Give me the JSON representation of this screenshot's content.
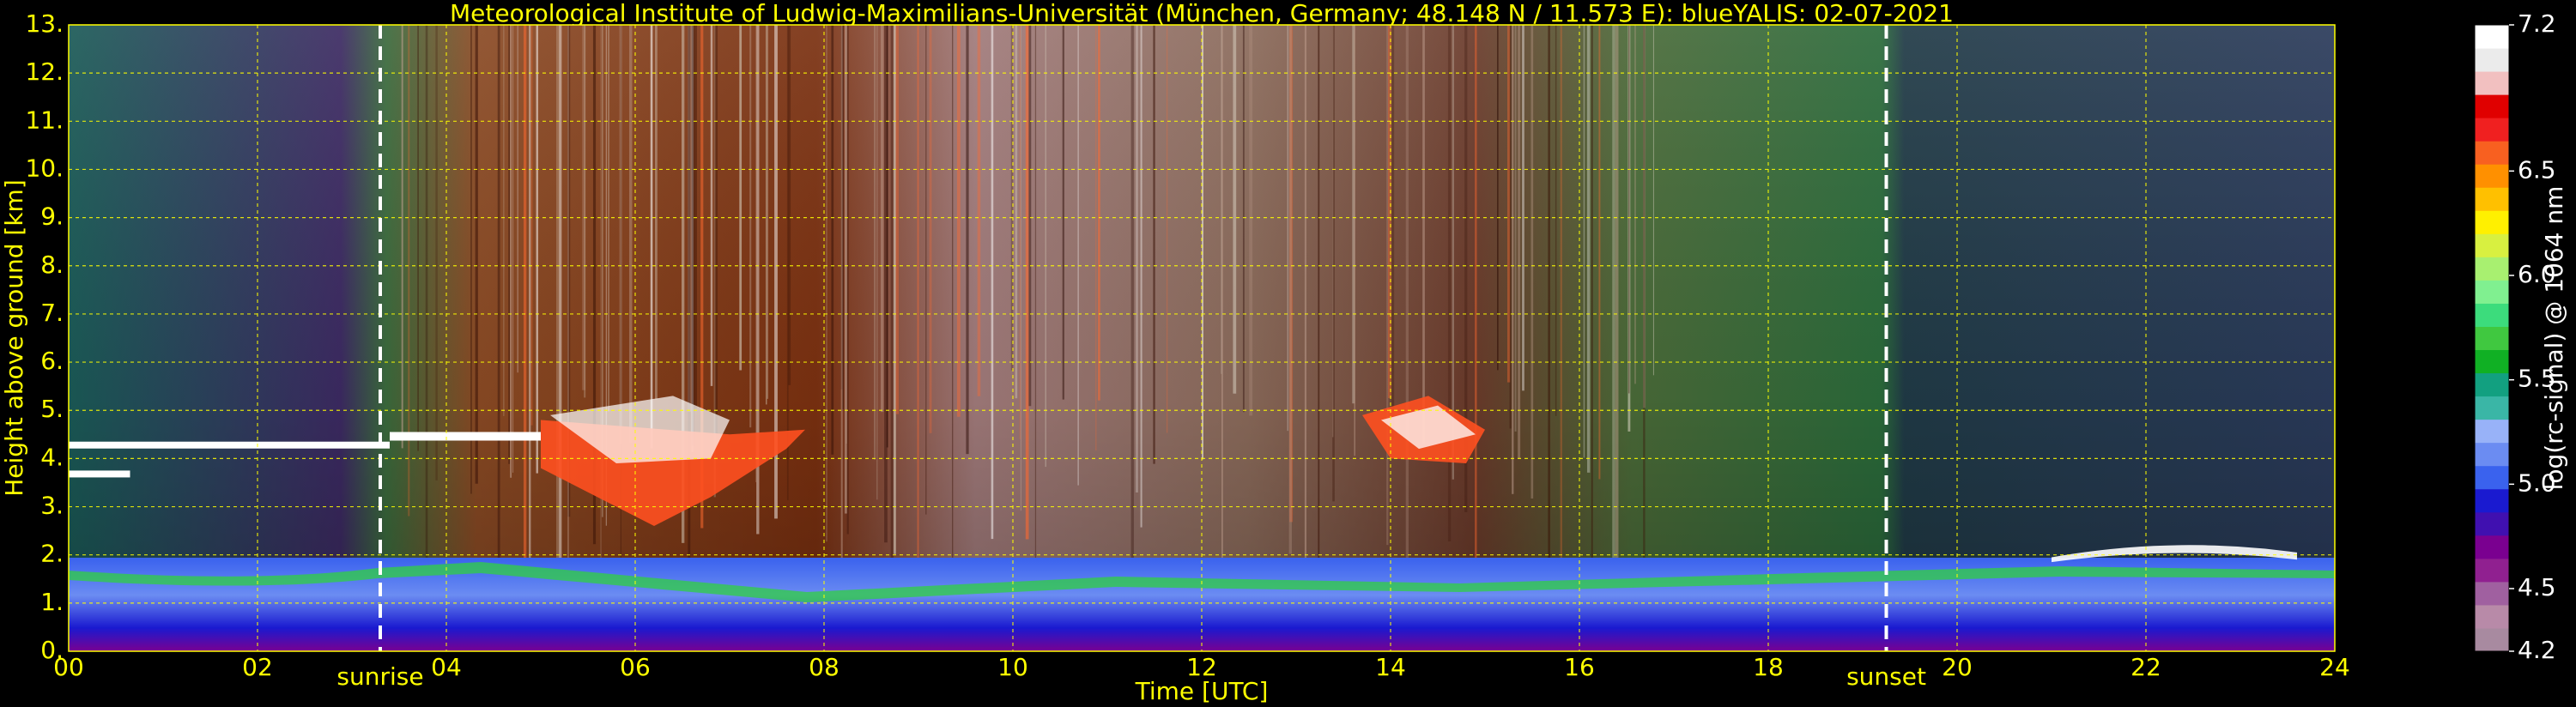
{
  "chart_data": {
    "type": "heatmap",
    "title": "Meteorological Institute of Ludwig-Maximilians-Universität (München, Germany; 48.148 N / 11.573 E):     blueYALIS: 02-07-2021",
    "xlabel": "Time [UTC]",
    "ylabel": "Height above ground [km]",
    "x_ticks": [
      "00",
      "02",
      "04",
      "06",
      "08",
      "10",
      "12",
      "14",
      "16",
      "18",
      "20",
      "22",
      "24"
    ],
    "y_ticks": [
      "0.",
      "1.",
      "2.",
      "3.",
      "4.",
      "5.",
      "6.",
      "7.",
      "8.",
      "9.",
      "10.",
      "11.",
      "12.",
      "13."
    ],
    "xlim": [
      0,
      24
    ],
    "ylim": [
      0,
      13
    ],
    "grid": true,
    "grid_color": "#ffff00",
    "events": [
      {
        "label": "sunrise",
        "x": 3.3
      },
      {
        "label": "sunset",
        "x": 19.25
      }
    ],
    "colorbar": {
      "label": "log(rc-signal) @ 1064 nm",
      "range": [
        4.2,
        7.2
      ],
      "ticks": [
        "7.2",
        "6.5",
        "6.0",
        "5.5",
        "5.0",
        "4.5",
        "4.2"
      ],
      "colors": [
        "#a88aa0",
        "#b88aa8",
        "#a060a0",
        "#902090",
        "#7a0090",
        "#4010b0",
        "#1a1ad0",
        "#3a62ee",
        "#6b8cf2",
        "#98b2f8",
        "#3ab6a6",
        "#12a080",
        "#10b024",
        "#40c840",
        "#3cdc7c",
        "#80f090",
        "#a8f070",
        "#d8f040",
        "#fff000",
        "#ffc000",
        "#ff9000",
        "#f86020",
        "#f02020",
        "#e00000",
        "#f2c0c0",
        "#ebebeb",
        "#ffffff"
      ]
    },
    "layers": [
      {
        "name": "boundary layer aerosol",
        "x_range": [
          0,
          24
        ],
        "height_top_km": 1.9
      },
      {
        "name": "cloud layer morning",
        "x_range": [
          0,
          3.4
        ],
        "height_km": 4.25
      },
      {
        "name": "cloud layer",
        "x_range": [
          3.4,
          7.8
        ],
        "height_km": [
          4.2,
          4.6
        ]
      },
      {
        "name": "cloud layer afternoon",
        "x_range": [
          13.6,
          15.0
        ],
        "height_km": [
          4.0,
          5.2
        ]
      },
      {
        "name": "cloud layer evening",
        "x_range": [
          21.0,
          23.5
        ],
        "height_km": 2.1
      }
    ]
  }
}
